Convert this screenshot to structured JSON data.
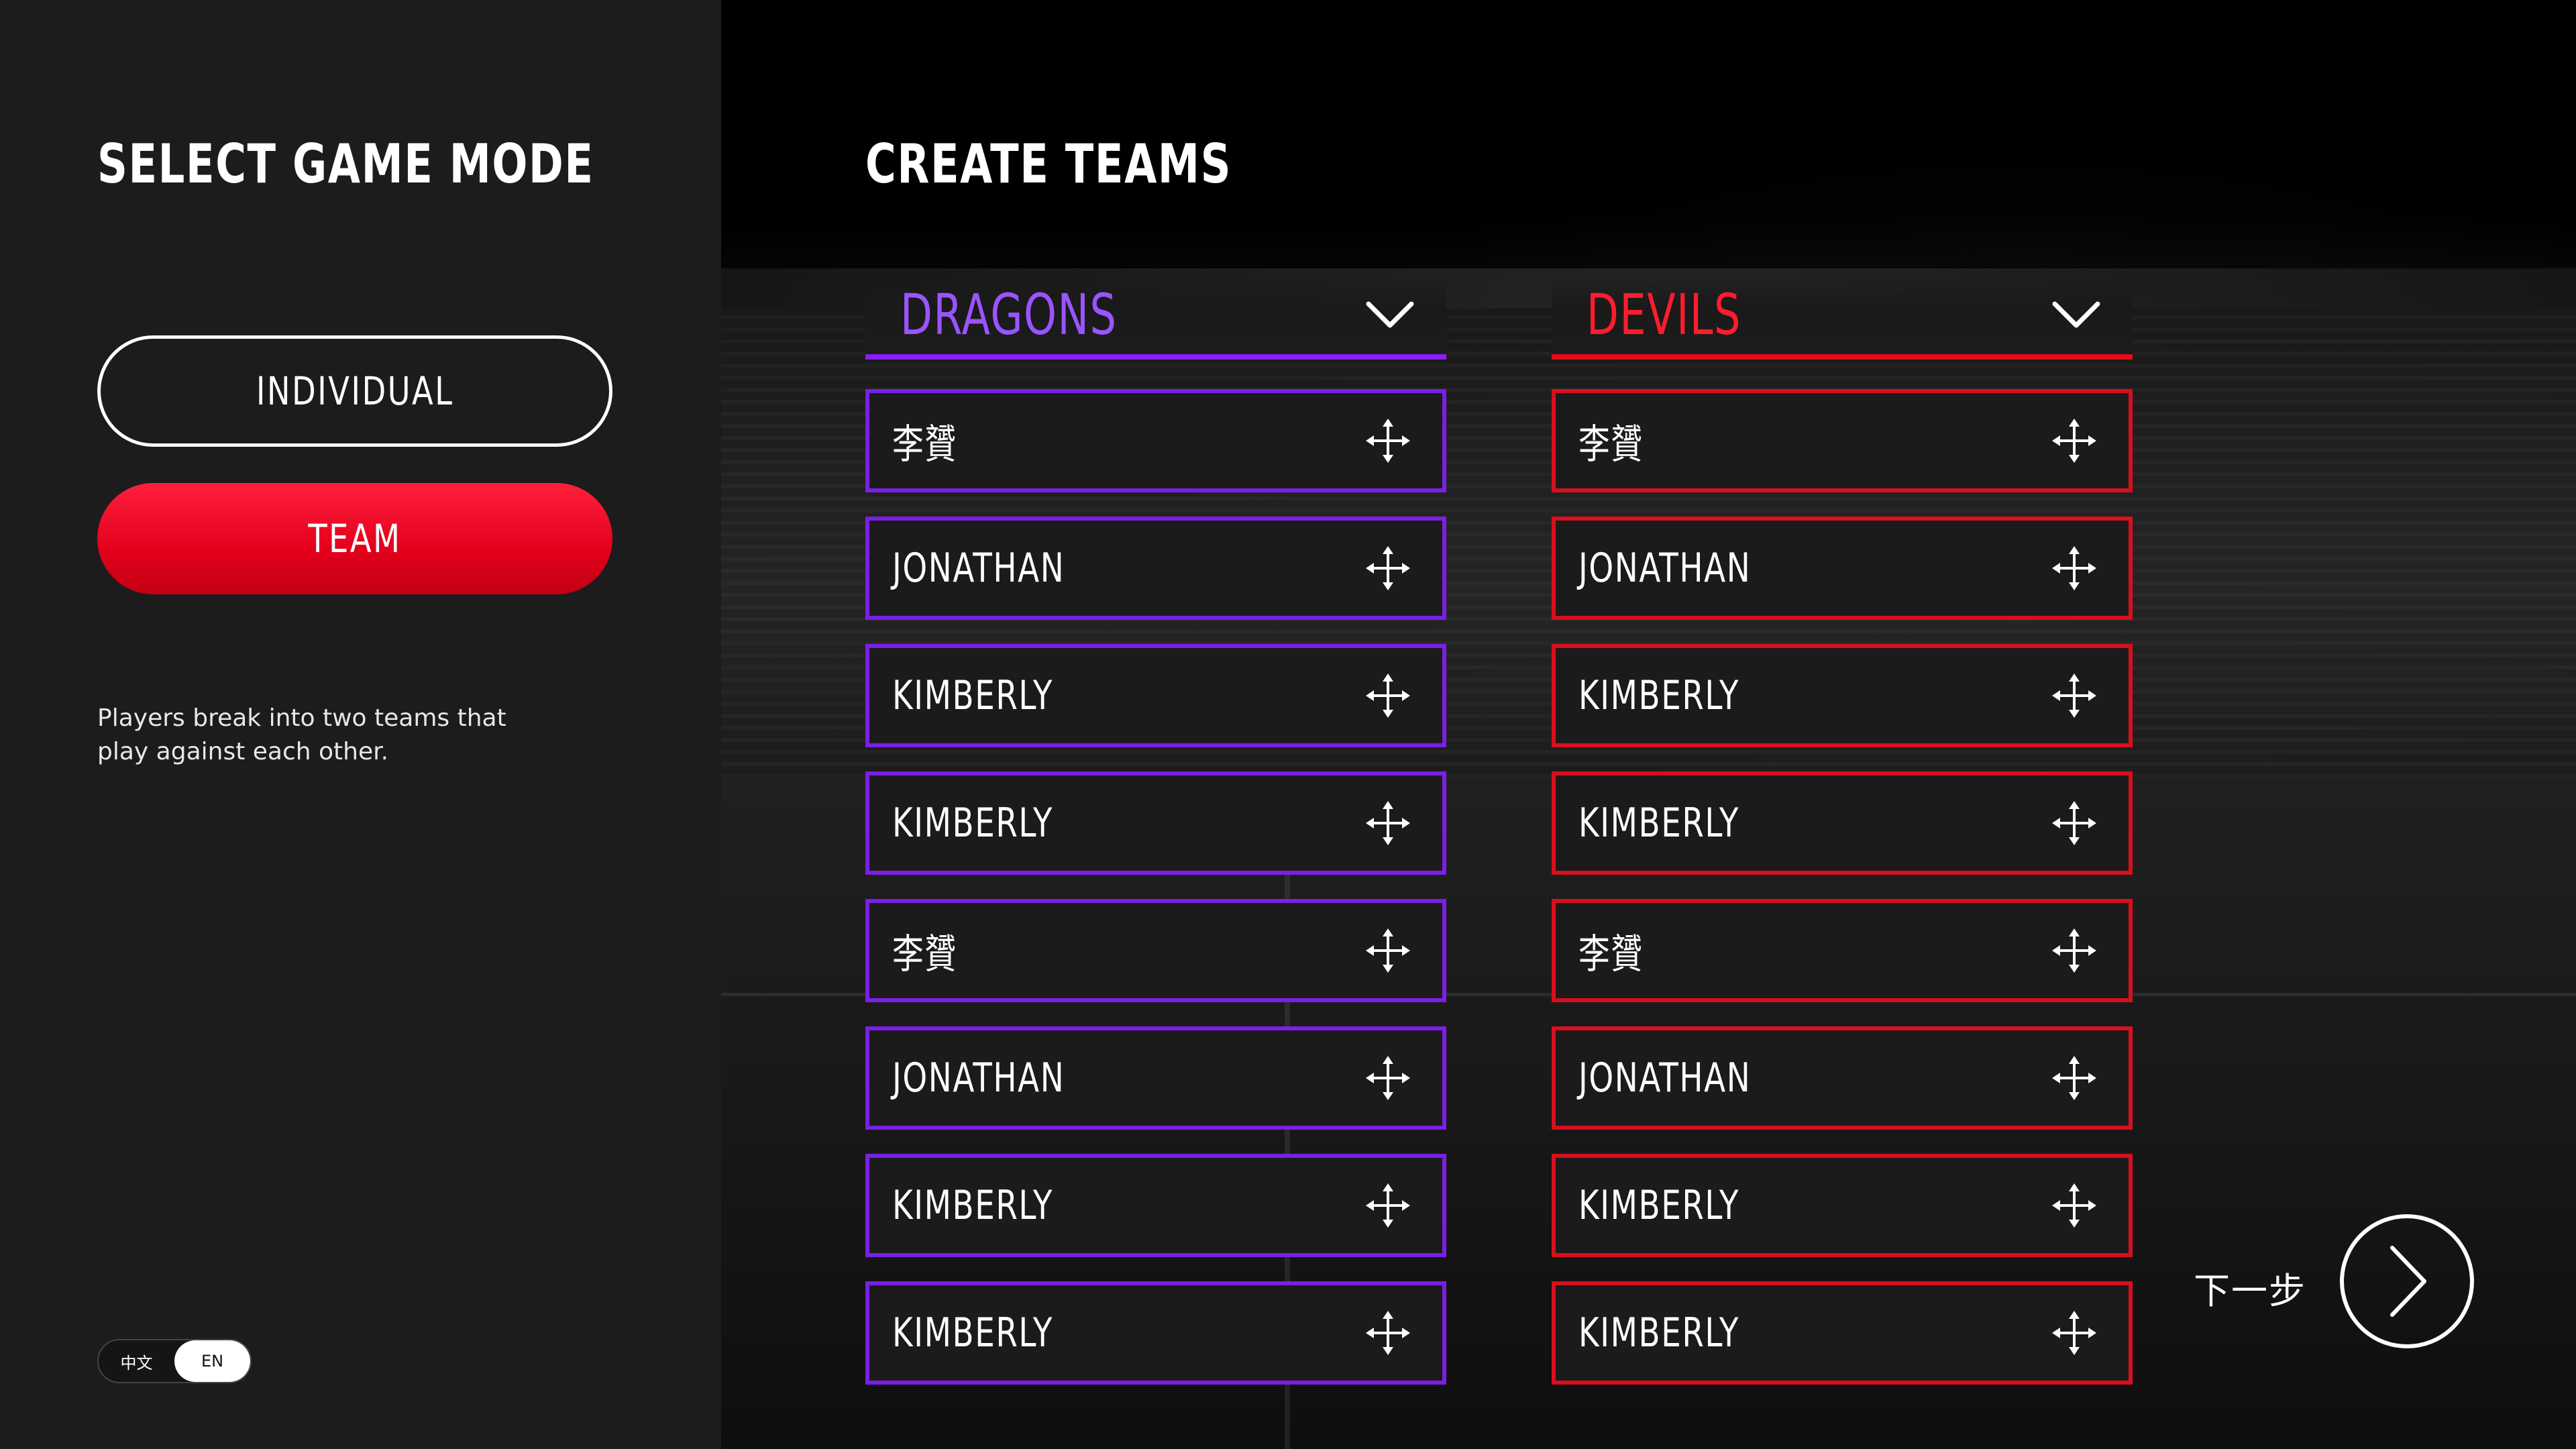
{
  "left_panel": {
    "title": "SELECT GAME MODE",
    "modes": [
      {
        "label": "INDIVIDUAL",
        "selected": false
      },
      {
        "label": "TEAM",
        "selected": true
      }
    ],
    "description": "Players break into two teams that play against each other.",
    "language": {
      "options": [
        "中文",
        "EN"
      ],
      "selected": "EN"
    }
  },
  "main": {
    "title": "CREATE TEAMS",
    "teams": [
      {
        "name": "DRAGONS",
        "color": "#8a1cff",
        "players": [
          "李贇",
          "JONATHAN",
          "KIMBERLY",
          "KIMBERLY",
          "李贇",
          "JONATHAN",
          "KIMBERLY",
          "KIMBERLY"
        ]
      },
      {
        "name": "DEVILS",
        "color": "#e40c1b",
        "players": [
          "李贇",
          "JONATHAN",
          "KIMBERLY",
          "KIMBERLY",
          "李贇",
          "JONATHAN",
          "KIMBERLY",
          "KIMBERLY"
        ]
      }
    ],
    "next": {
      "label": "下一步",
      "icon": "chevron-right-icon"
    }
  },
  "icons": {
    "dropdown": "chevron-down-icon",
    "drag": "move-icon"
  }
}
